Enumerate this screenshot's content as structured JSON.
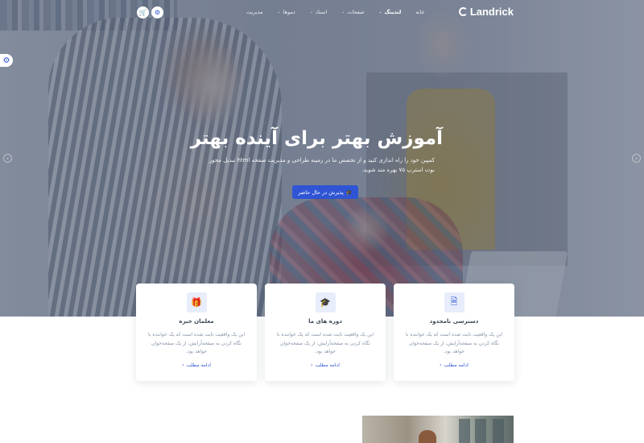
{
  "nav": {
    "logo_text": "Landrick",
    "menu": [
      {
        "label": "خانه",
        "has_caret": false,
        "active": false
      },
      {
        "label": "لندینگ",
        "has_caret": true,
        "active": true
      },
      {
        "label": "صفحات",
        "has_caret": true,
        "active": false
      },
      {
        "label": "اسناد",
        "has_caret": true,
        "active": false
      },
      {
        "label": "دموها",
        "has_caret": true,
        "active": false
      },
      {
        "label": "مدیریت",
        "has_caret": false,
        "active": false
      }
    ],
    "cart_icon": "cart-icon",
    "settings_icon": "settings-icon"
  },
  "hero": {
    "title": "آموزش بهتر برای آینده بهتر",
    "description": "کمپین خود را راه اندازی کنید و از تخصص ما در زمینه طراحی و مدیریت صفحه html تبدیل محور بوت استرپ ۷۵ بهره مند شوید.",
    "cta_label": "پذیرش در حال حاضر",
    "cta_icon": "graduation-cap-icon"
  },
  "cards": [
    {
      "icon": "gift-icon",
      "icon_glyph": "🎁",
      "title": "معلمان خبره",
      "text": "این یک واقعیت ثابت شده است که یک خواننده با نگاه کردن به صفحه‌آرایش، از یک صفحه‌خوان خواهد بود.",
      "link": "ادامه مطلب"
    },
    {
      "icon": "graduation-cap-icon",
      "icon_glyph": "🎓",
      "title": "دوره های ما",
      "text": "این یک واقعیت ثابت شده است که یک خواننده با نگاه کردن به صفحه‌آرایش، از یک صفحه‌خوان خواهد بود.",
      "link": "ادامه مطلب"
    },
    {
      "icon": "document-icon",
      "icon_glyph": "🗎",
      "title": "دسترسی نامحدود",
      "text": "این یک واقعیت ثابت شده است که یک خواننده با نگاه کردن به صفحه‌آرایش، از یک صفحه‌خوان خواهد بود.",
      "link": "ادامه مطلب"
    }
  ],
  "colors": {
    "primary": "#2f55d4",
    "heading": "#3c4858",
    "muted": "#8492a6",
    "icon_bg": "#e8edfb"
  }
}
